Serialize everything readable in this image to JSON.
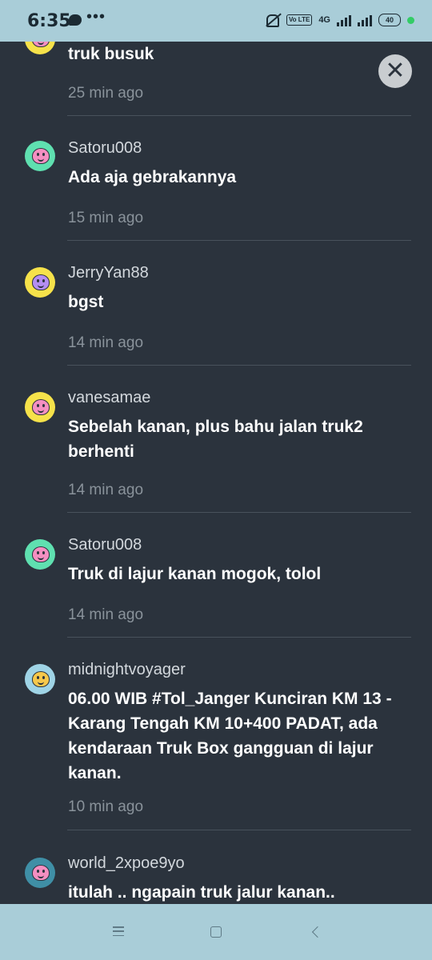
{
  "status_bar": {
    "time": "6:35",
    "dots": "•••",
    "network": "4G",
    "volte": "Vo LTE",
    "battery": "40"
  },
  "comments": [
    {
      "username": "",
      "text": "truk busuk",
      "time": "25 min ago",
      "avatar": "yellow"
    },
    {
      "username": "Satoru008",
      "text": "Ada aja gebrakannya",
      "time": "15 min ago",
      "avatar": "green"
    },
    {
      "username": "JerryYan88",
      "text": "bgst",
      "time": "14 min ago",
      "avatar": "yellow-purple"
    },
    {
      "username": "vanesamae",
      "text": "Sebelah kanan, plus bahu jalan truk2 berhenti",
      "time": "14 min ago",
      "avatar": "yellow"
    },
    {
      "username": "Satoru008",
      "text": "Truk di lajur kanan mogok, tolol",
      "time": "14 min ago",
      "avatar": "green"
    },
    {
      "username": "midnightvoyager",
      "text": "06.00 WIB #Tol_Janger  Kunciran KM 13 - Karang Tengah KM 10+400 PADAT, ada kendaraan Truk Box gangguan di lajur kanan.",
      "time": "10 min ago",
      "avatar": "light-blue"
    },
    {
      "username": "world_2xpoe9yo",
      "text": "itulah .. ngapain truk jalur kanan..",
      "time": "",
      "avatar": "teal"
    }
  ],
  "close_label": "✕",
  "colors": {
    "background": "#2b333d",
    "system_bar": "#a9cdd8",
    "avatar_yellow": "#f6e24a",
    "avatar_green": "#5fe0b0",
    "avatar_light_blue": "#9fd4e6",
    "avatar_teal": "#3f8fa6"
  }
}
